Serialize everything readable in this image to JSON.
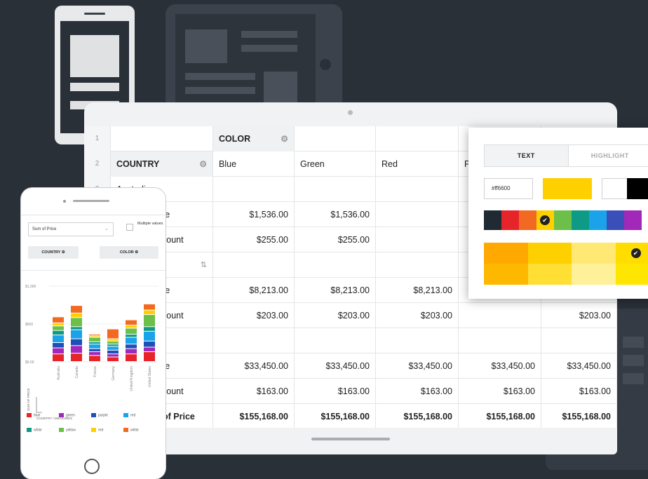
{
  "table": {
    "row_numbers": [
      "1",
      "2",
      "3"
    ],
    "column_header": "COLOR",
    "row_header": "COUNTRY",
    "colors": [
      "Blue",
      "Green",
      "Red",
      "P"
    ],
    "country": "Australia",
    "rows": [
      {
        "label": "rice",
        "values": [
          "$1,536.00",
          "$1,536.00",
          "",
          "",
          ""
        ]
      },
      {
        "label": "iscount",
        "values": [
          "$255.00",
          "$255.00",
          "",
          "",
          ""
        ]
      },
      {
        "label": "",
        "values": [
          "",
          "",
          "",
          "",
          ""
        ]
      },
      {
        "label": "rice",
        "values": [
          "$8,213.00",
          "$8,213.00",
          "$8,213.00",
          "",
          ""
        ]
      },
      {
        "label": "iscount",
        "values": [
          "$203.00",
          "$203.00",
          "$203.00",
          "",
          "$203.00"
        ]
      },
      {
        "label": "",
        "values": [
          "",
          "",
          "",
          "",
          ""
        ]
      },
      {
        "label": "rice",
        "values": [
          "$33,450.00",
          "$33,450.00",
          "$33,450.00",
          "$33,450.00",
          "$33,450.00"
        ]
      },
      {
        "label": "iscount",
        "values": [
          "$163.00",
          "$163.00",
          "$163.00",
          "$163.00",
          "$163.00"
        ]
      },
      {
        "label": "of Price",
        "values": [
          "$155,168.00",
          "$155,168.00",
          "$155,168.00",
          "$155,168.00",
          "$155,168.00"
        ]
      }
    ]
  },
  "color_popup": {
    "tab_text": "TEXT",
    "tab_highlight": "HIGHLIGHT",
    "hex_value": "#ff6600",
    "palette": [
      "#1f2a33",
      "#e8242b",
      "#f26a21",
      "#ffd000",
      "#6cc04a",
      "#0e9a84",
      "#1aa3e8",
      "#3b4fb8",
      "#a128b8"
    ],
    "shades": [
      "#ffa800",
      "#ffd000",
      "#ffe873",
      "#ffdd00",
      "#ffb800",
      "#ffdf33",
      "#fff09a",
      "#ffe600"
    ]
  },
  "mobile": {
    "measure_select": "Sum of Price",
    "multiple_values": "Multiple values",
    "pill_country": "COUNTRY",
    "pill_color": "COLOR",
    "legend": [
      {
        "name": "blue",
        "color": "#e8242b"
      },
      {
        "name": "green",
        "color": "#a128b8"
      },
      {
        "name": "purple",
        "color": "#1f4fb8"
      },
      {
        "name": "red",
        "color": "#1aa3e8"
      },
      {
        "name": "white",
        "color": "#0e9a84"
      },
      {
        "name": "yellow",
        "color": "#6cc04a"
      },
      {
        "name": "red",
        "color": "#ffd000"
      },
      {
        "name": "white",
        "color": "#f26a21"
      }
    ]
  },
  "chart_data": {
    "type": "bar",
    "stacked": true,
    "categories": [
      "Australia",
      "Canada",
      "France",
      "Germany",
      "United Kingdom",
      "United States"
    ],
    "yticks": [
      "$1,000",
      "$500",
      "$0.00"
    ],
    "ylim": [
      0,
      1000
    ],
    "ylabel": "SUM OF PRICE",
    "xlabel": "COUNTRY / MEASURES",
    "series": [
      {
        "color": "#e8242b",
        "values": [
          100,
          110,
          80,
          60,
          100,
          130
        ]
      },
      {
        "color": "#a128b8",
        "values": [
          80,
          100,
          50,
          40,
          70,
          60
        ]
      },
      {
        "color": "#1f4fb8",
        "values": [
          70,
          90,
          40,
          50,
          60,
          80
        ]
      },
      {
        "color": "#1aa3e8",
        "values": [
          100,
          120,
          60,
          50,
          90,
          130
        ]
      },
      {
        "color": "#0e9a84",
        "values": [
          60,
          40,
          30,
          30,
          40,
          60
        ]
      },
      {
        "color": "#6cc04a",
        "values": [
          60,
          120,
          60,
          40,
          80,
          160
        ]
      },
      {
        "color": "#ffd000",
        "values": [
          40,
          60,
          20,
          30,
          40,
          60
        ]
      },
      {
        "color": "#f26a21",
        "values": [
          80,
          100,
          20,
          130,
          70,
          80
        ]
      }
    ]
  }
}
